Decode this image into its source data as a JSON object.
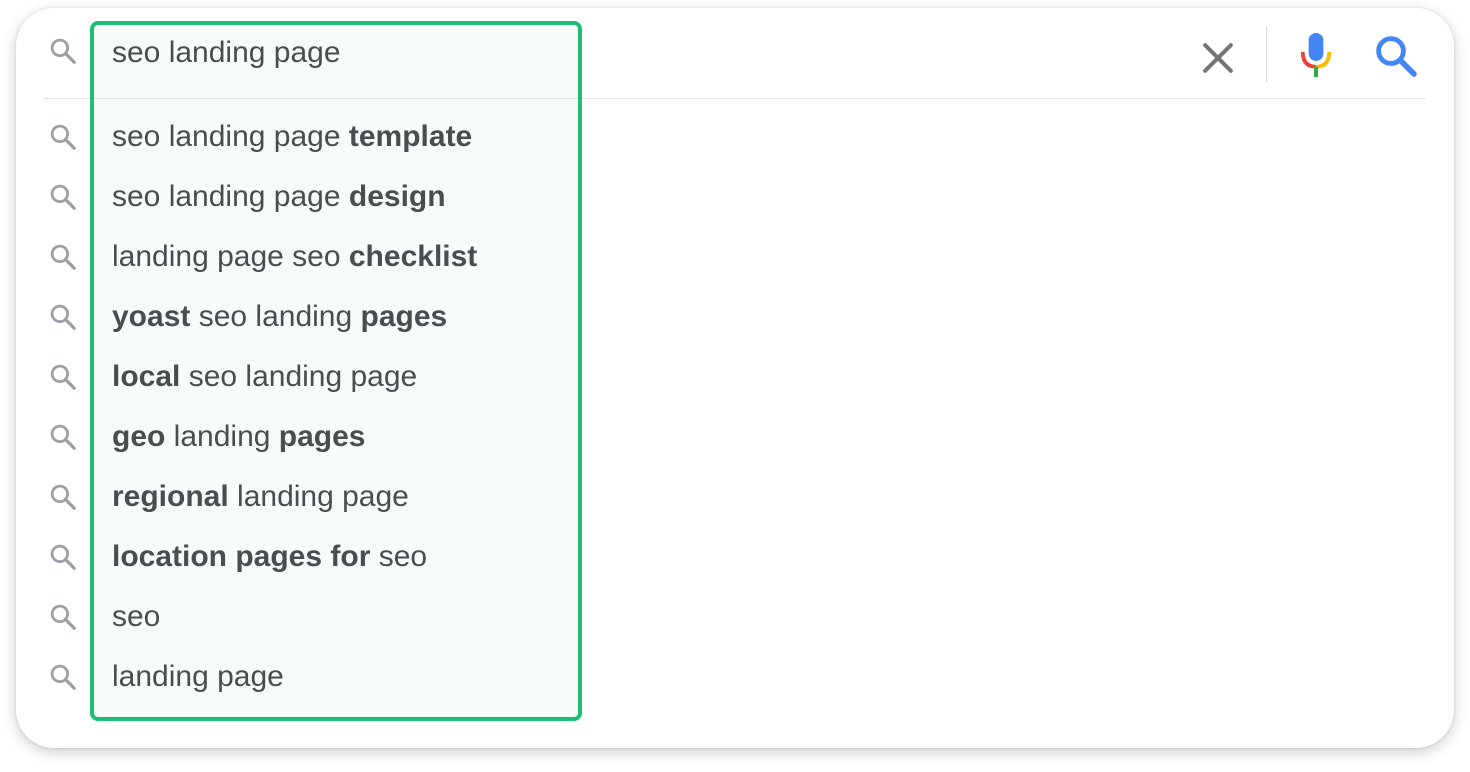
{
  "search": {
    "query": "seo landing page"
  },
  "suggestions": [
    {
      "parts": [
        {
          "text": "seo landing page ",
          "bold": false
        },
        {
          "text": "template",
          "bold": true
        }
      ]
    },
    {
      "parts": [
        {
          "text": "seo landing page ",
          "bold": false
        },
        {
          "text": "design",
          "bold": true
        }
      ]
    },
    {
      "parts": [
        {
          "text": "landing page seo ",
          "bold": false
        },
        {
          "text": "checklist",
          "bold": true
        }
      ]
    },
    {
      "parts": [
        {
          "text": "yoast",
          "bold": true
        },
        {
          "text": " seo landing ",
          "bold": false
        },
        {
          "text": "pages",
          "bold": true
        }
      ]
    },
    {
      "parts": [
        {
          "text": "local",
          "bold": true
        },
        {
          "text": " seo landing page",
          "bold": false
        }
      ]
    },
    {
      "parts": [
        {
          "text": "geo",
          "bold": true
        },
        {
          "text": " landing ",
          "bold": false
        },
        {
          "text": "pages",
          "bold": true
        }
      ]
    },
    {
      "parts": [
        {
          "text": "regional",
          "bold": true
        },
        {
          "text": " landing page",
          "bold": false
        }
      ]
    },
    {
      "parts": [
        {
          "text": "location pages for",
          "bold": true
        },
        {
          "text": " seo",
          "bold": false
        }
      ]
    },
    {
      "parts": [
        {
          "text": "seo",
          "bold": false
        }
      ]
    },
    {
      "parts": [
        {
          "text": "landing page",
          "bold": false
        }
      ]
    }
  ],
  "icons": {
    "leading": "search-icon",
    "suggestion": "search-icon",
    "clear": "close-icon",
    "voice": "microphone-icon",
    "submit": "search-icon"
  },
  "colors": {
    "highlight_border": "#1dbf73",
    "submit_icon": "#4285f4",
    "suggestion_icon": "#9aa0a6",
    "text": "#202124"
  }
}
